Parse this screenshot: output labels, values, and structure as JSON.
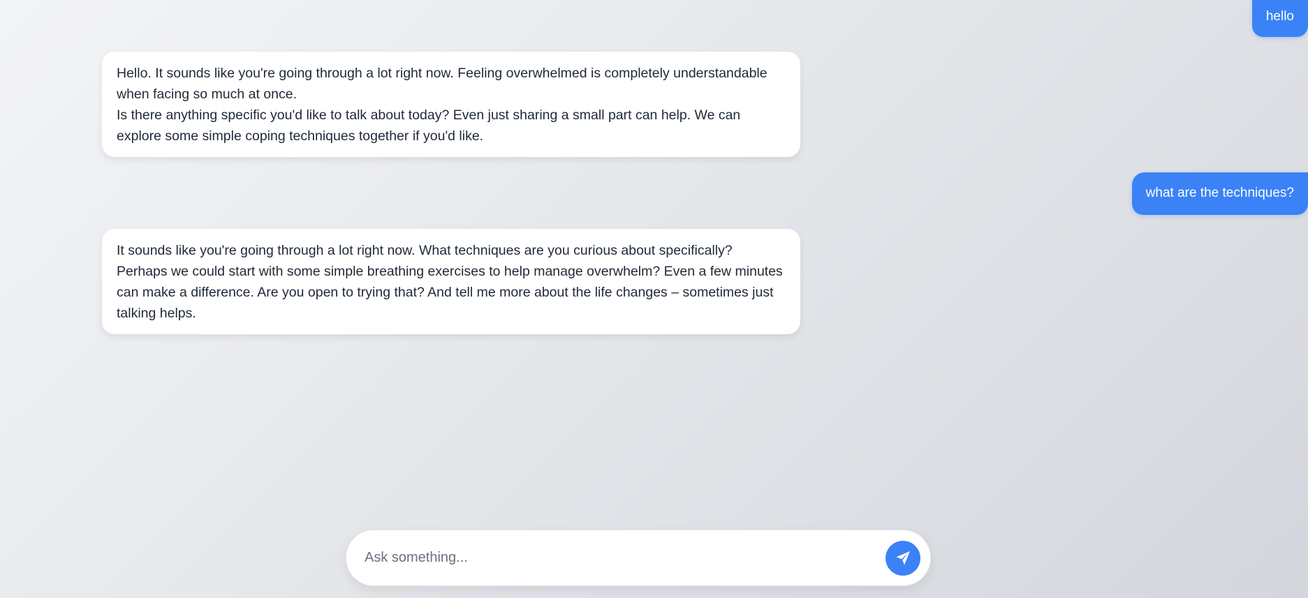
{
  "colors": {
    "accent": "#3b82f6",
    "assistant_bubble_bg": "#ffffff",
    "text": "#1f2937"
  },
  "messages": [
    {
      "role": "user",
      "text": "hello"
    },
    {
      "role": "assistant",
      "paragraphs": [
        "Hello. It sounds like you're going through a lot right now. Feeling overwhelmed is completely understandable when facing so much at once.",
        "Is there anything specific you'd like to talk about today? Even just sharing a small part can help. We can explore some simple coping techniques together if you'd like."
      ]
    },
    {
      "role": "user",
      "text": "what are the techniques?"
    },
    {
      "role": "assistant",
      "paragraphs": [
        "It sounds like you're going through a lot right now. What techniques are you curious about specifically? Perhaps we could start with some simple breathing exercises to help manage overwhelm? Even a few minutes can make a difference. Are you open to trying that? And tell me more about the life changes – sometimes just talking helps."
      ]
    }
  ],
  "composer": {
    "placeholder": "Ask something...",
    "value": "",
    "send_icon": "paper-plane-icon"
  }
}
